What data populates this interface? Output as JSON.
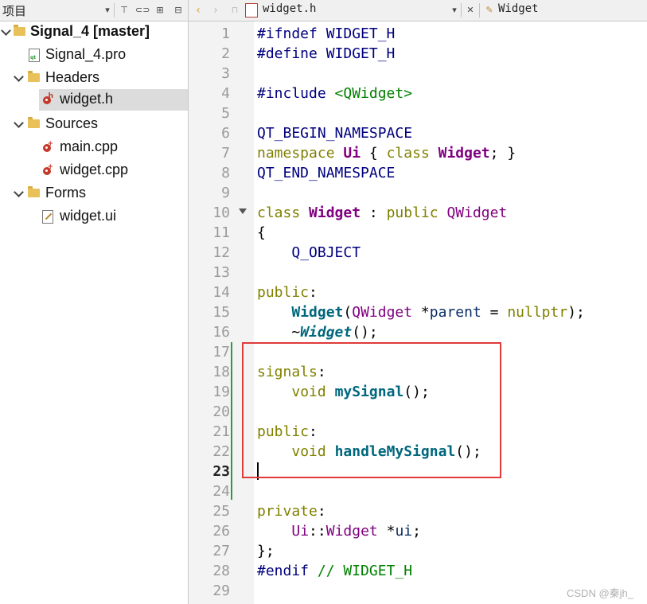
{
  "toolbar": {
    "project_label": "项目",
    "file_tab": "widget.h",
    "class_tab": "Widget"
  },
  "tree": {
    "project": "Signal_4 [master]",
    "pro_file": "Signal_4.pro",
    "headers": "Headers",
    "header_file": "widget.h",
    "sources": "Sources",
    "source_main": "main.cpp",
    "source_widget": "widget.cpp",
    "forms": "Forms",
    "form_file": "widget.ui"
  },
  "editor": {
    "current_line": 23,
    "line_numbers": [
      "1",
      "2",
      "3",
      "4",
      "5",
      "6",
      "7",
      "8",
      "9",
      "10",
      "11",
      "12",
      "13",
      "14",
      "15",
      "16",
      "17",
      "18",
      "19",
      "20",
      "21",
      "22",
      "23",
      "24",
      "25",
      "26",
      "27",
      "28",
      "29"
    ],
    "tokens": {
      "l1_a": "#ifndef",
      "l1_b": " WIDGET_H",
      "l2_a": "#define",
      "l2_b": " WIDGET_H",
      "l4_a": "#include",
      "l4_b": " <QWidget>",
      "l6": "QT_BEGIN_NAMESPACE",
      "l7_a": "namespace",
      "l7_b": "Ui",
      "l7_c": " { ",
      "l7_d": "class",
      "l7_e": "Widget",
      "l7_f": "; }",
      "l8": "QT_END_NAMESPACE",
      "l10_a": "class",
      "l10_b": "Widget",
      "l10_c": " : ",
      "l10_d": "public",
      "l10_e": "QWidget",
      "l11": "{",
      "l12": "Q_OBJECT",
      "l14_a": "public",
      "l14_b": ":",
      "l15_a": "Widget",
      "l15_b": "(",
      "l15_c": "QWidget",
      "l15_d": " *",
      "l15_e": "parent",
      "l15_f": " = ",
      "l15_g": "nullptr",
      "l15_h": ");",
      "l16_a": "~",
      "l16_b": "Widget",
      "l16_c": "();",
      "l18_a": "signals",
      "l18_b": ":",
      "l19_a": "void",
      "l19_b": "mySignal",
      "l19_c": "();",
      "l21_a": "public",
      "l21_b": ":",
      "l22_a": "void",
      "l22_b": "handleMySignal",
      "l22_c": "();",
      "l25_a": "private",
      "l25_b": ":",
      "l26_a": "Ui",
      "l26_b": "::",
      "l26_c": "Widget",
      "l26_d": " *",
      "l26_e": "ui",
      "l26_f": ";",
      "l27": "};",
      "l28_a": "#endif",
      "l28_b": " // WIDGET_H"
    }
  },
  "watermark": "CSDN @秦jh_",
  "colors": {
    "preprocessor": "#000080",
    "keyword": "#808000",
    "class": "#800080",
    "function": "#00677c",
    "highlight_box": "#e03a3a"
  }
}
